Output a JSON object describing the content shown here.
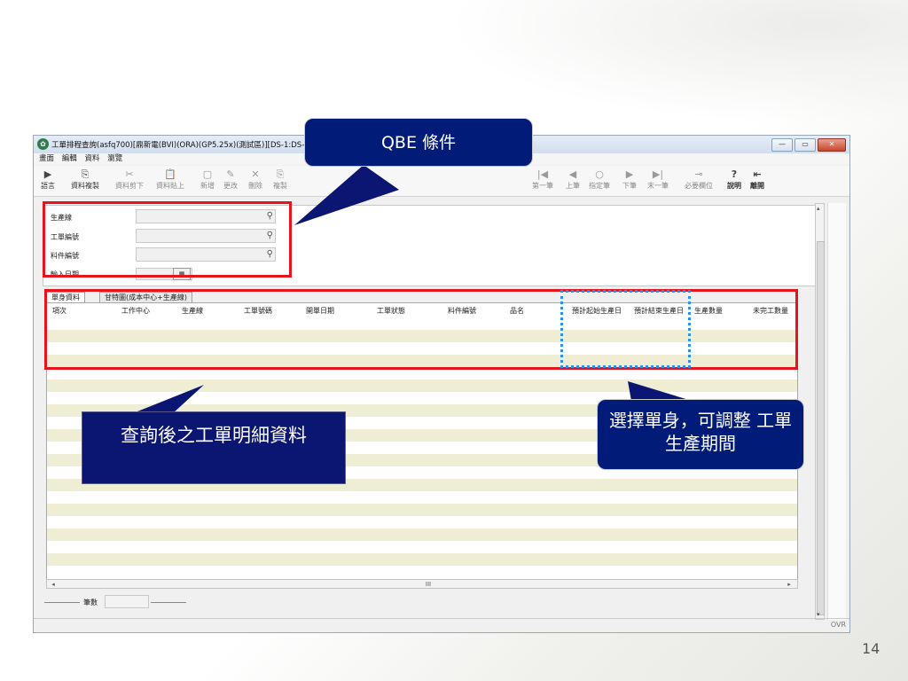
{
  "window": {
    "title": "工單排程查詢(asfq700)[鼎新電(BVI)(ORA)(GP5.25x)(測試區)][DS-1:DS-",
    "buttons": [
      "—",
      "▭",
      "✕"
    ]
  },
  "menu": [
    "畫面",
    "編輯",
    "資料",
    "瀏覽"
  ],
  "toolbar": {
    "left": [
      {
        "label": "語言",
        "icon": "▶"
      },
      {
        "label": "資料複製",
        "icon": "⎘"
      },
      {
        "label": "資料剪下",
        "icon": "✂"
      },
      {
        "label": "資料貼上",
        "icon": "📋"
      },
      {
        "label": "新增",
        "icon": "▢"
      },
      {
        "label": "更改",
        "icon": "✎"
      },
      {
        "label": "刪除",
        "icon": "✕"
      },
      {
        "label": "複製",
        "icon": "⎘"
      }
    ],
    "right": [
      {
        "label": "第一筆",
        "icon": "|◀"
      },
      {
        "label": "上筆",
        "icon": "◀"
      },
      {
        "label": "指定筆",
        "icon": "○"
      },
      {
        "label": "下筆",
        "icon": "▶"
      },
      {
        "label": "末一筆",
        "icon": "▶|"
      },
      {
        "label": "必要欄位",
        "icon": "⊸"
      },
      {
        "label": "說明",
        "icon": "?"
      },
      {
        "label": "離開",
        "icon": "⇤"
      }
    ]
  },
  "qbe_fields": [
    {
      "label": "生產線"
    },
    {
      "label": "工單編號"
    },
    {
      "label": "料件編號"
    },
    {
      "label": "輸入日期"
    }
  ],
  "tabs": [
    "單身資料",
    "甘特圖(成本中心+生產線)"
  ],
  "grid": {
    "columns": [
      "項次",
      "工作中心",
      "生產線",
      "工單號碼",
      "開單日期",
      "工單狀態",
      "料件編號",
      "品名",
      "預計起始生產日",
      "預計結束生產日",
      "生產數量",
      "未完工數量"
    ]
  },
  "scroll_mid": "III",
  "count_label": "筆數",
  "status": {
    "ovr": "OVR"
  },
  "callouts": {
    "qbe": "QBE 條件",
    "detail": "查詢後之工單明細資料",
    "select": "選擇單身，可調整 工單生產期間"
  },
  "page_number": "14",
  "colors": {
    "highlight_red": "#e8141b",
    "highlight_blue": "#2f8ee6",
    "callout_navy": "#0b1572"
  }
}
